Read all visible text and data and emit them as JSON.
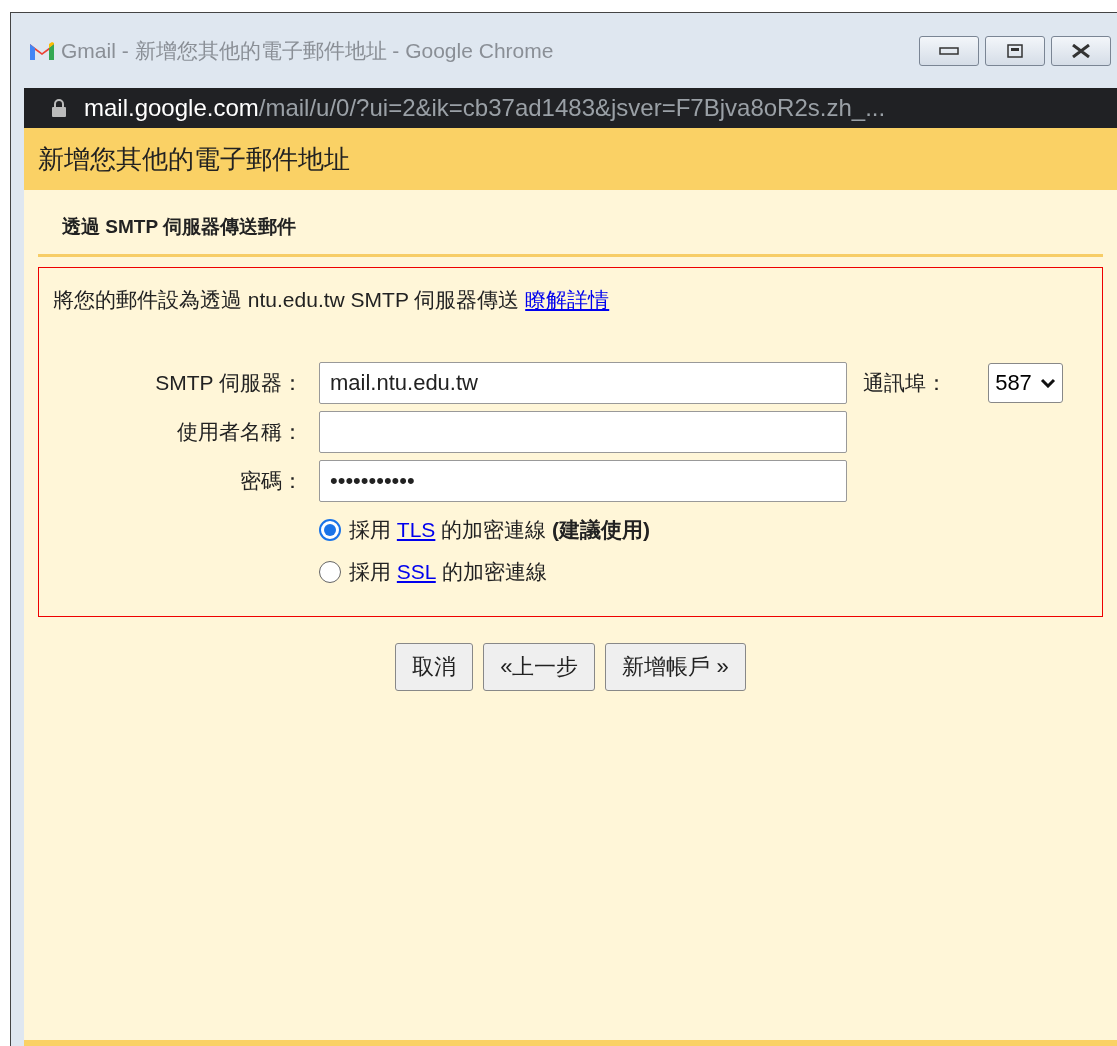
{
  "window": {
    "title": "Gmail - 新增您其他的電子郵件地址 - Google Chrome",
    "controls": [
      {
        "kind": "minimize"
      },
      {
        "kind": "maximize"
      },
      {
        "kind": "close"
      }
    ]
  },
  "address_bar": {
    "host": "mail.google.com",
    "path": "/mail/u/0/?ui=2&ik=cb37ad1483&jsver=F7Bjva8oR2s.zh_..."
  },
  "dialog": {
    "title": "新增您其他的電子郵件地址",
    "subtitle": "透過 SMTP 伺服器傳送郵件",
    "intro": "將您的郵件設為透過 ntu.edu.tw SMTP 伺服器傳送",
    "learn_more": "瞭解詳情",
    "fields": [
      {
        "label": "SMTP 伺服器：",
        "value": "mail.ntu.edu.tw"
      },
      {
        "label": "使用者名稱："
      },
      {
        "label": "密碼：",
        "value": "•••••••••••"
      }
    ],
    "port": {
      "label": "通訊埠：",
      "value": "587"
    },
    "encryption": [
      {
        "prefix": "採用",
        "link": "TLS",
        "suffix": "的加密連線",
        "note": "(建議使用)",
        "selected": true
      },
      {
        "prefix": "採用",
        "link": "SSL",
        "suffix": "的加密連線",
        "selected": false
      }
    ],
    "buttons": [
      "取消",
      "«上一步",
      "新增帳戶 »"
    ]
  }
}
